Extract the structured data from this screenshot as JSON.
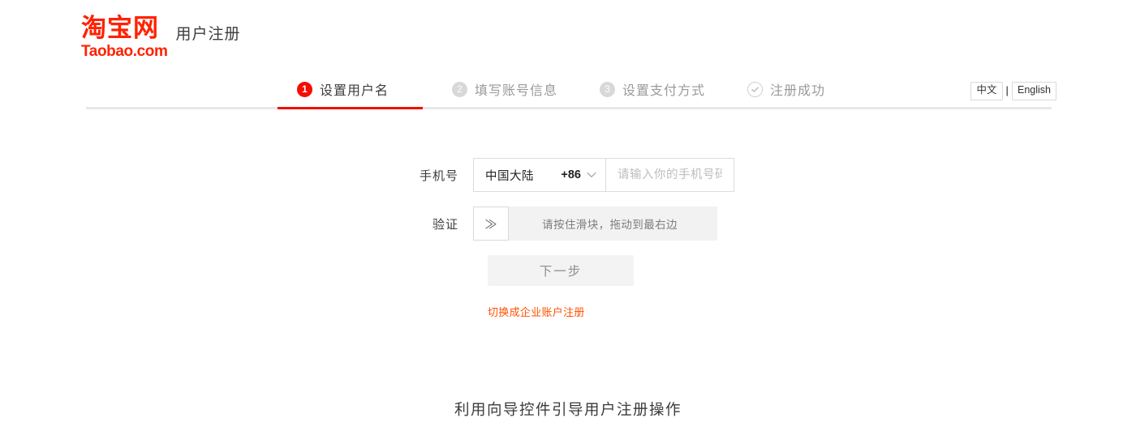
{
  "header": {
    "logo_cn": "淘宝网",
    "logo_en": "Taobao.com",
    "page_title": "用户注册",
    "brand_color": "#ff2200"
  },
  "steps": {
    "active_index": 1,
    "items": [
      {
        "badge": "1",
        "label": "设置用户名",
        "state": "active"
      },
      {
        "badge": "2",
        "label": "填写账号信息",
        "state": "inactive"
      },
      {
        "badge": "3",
        "label": "设置支付方式",
        "state": "inactive"
      },
      {
        "badge": "check-icon",
        "label": "注册成功",
        "state": "inactive"
      }
    ],
    "active_color": "#f40d00",
    "divider_color": "#e8e8e8"
  },
  "language": {
    "current": "中文",
    "other": "English",
    "separator": "|"
  },
  "form": {
    "phone": {
      "label": "手机号",
      "country_name": "中国大陆",
      "country_code": "+86",
      "chevron": "chevron-down-icon",
      "placeholder": "请输入你的手机号码",
      "value": ""
    },
    "captcha": {
      "label": "验证",
      "handle_glyph": "≫",
      "track_text": "请按住滑块，拖动到最右边"
    },
    "next_button": "下一步",
    "switch_link": "切换成企业账户注册",
    "link_color": "#ff5000"
  },
  "caption": "利用向导控件引导用户注册操作"
}
